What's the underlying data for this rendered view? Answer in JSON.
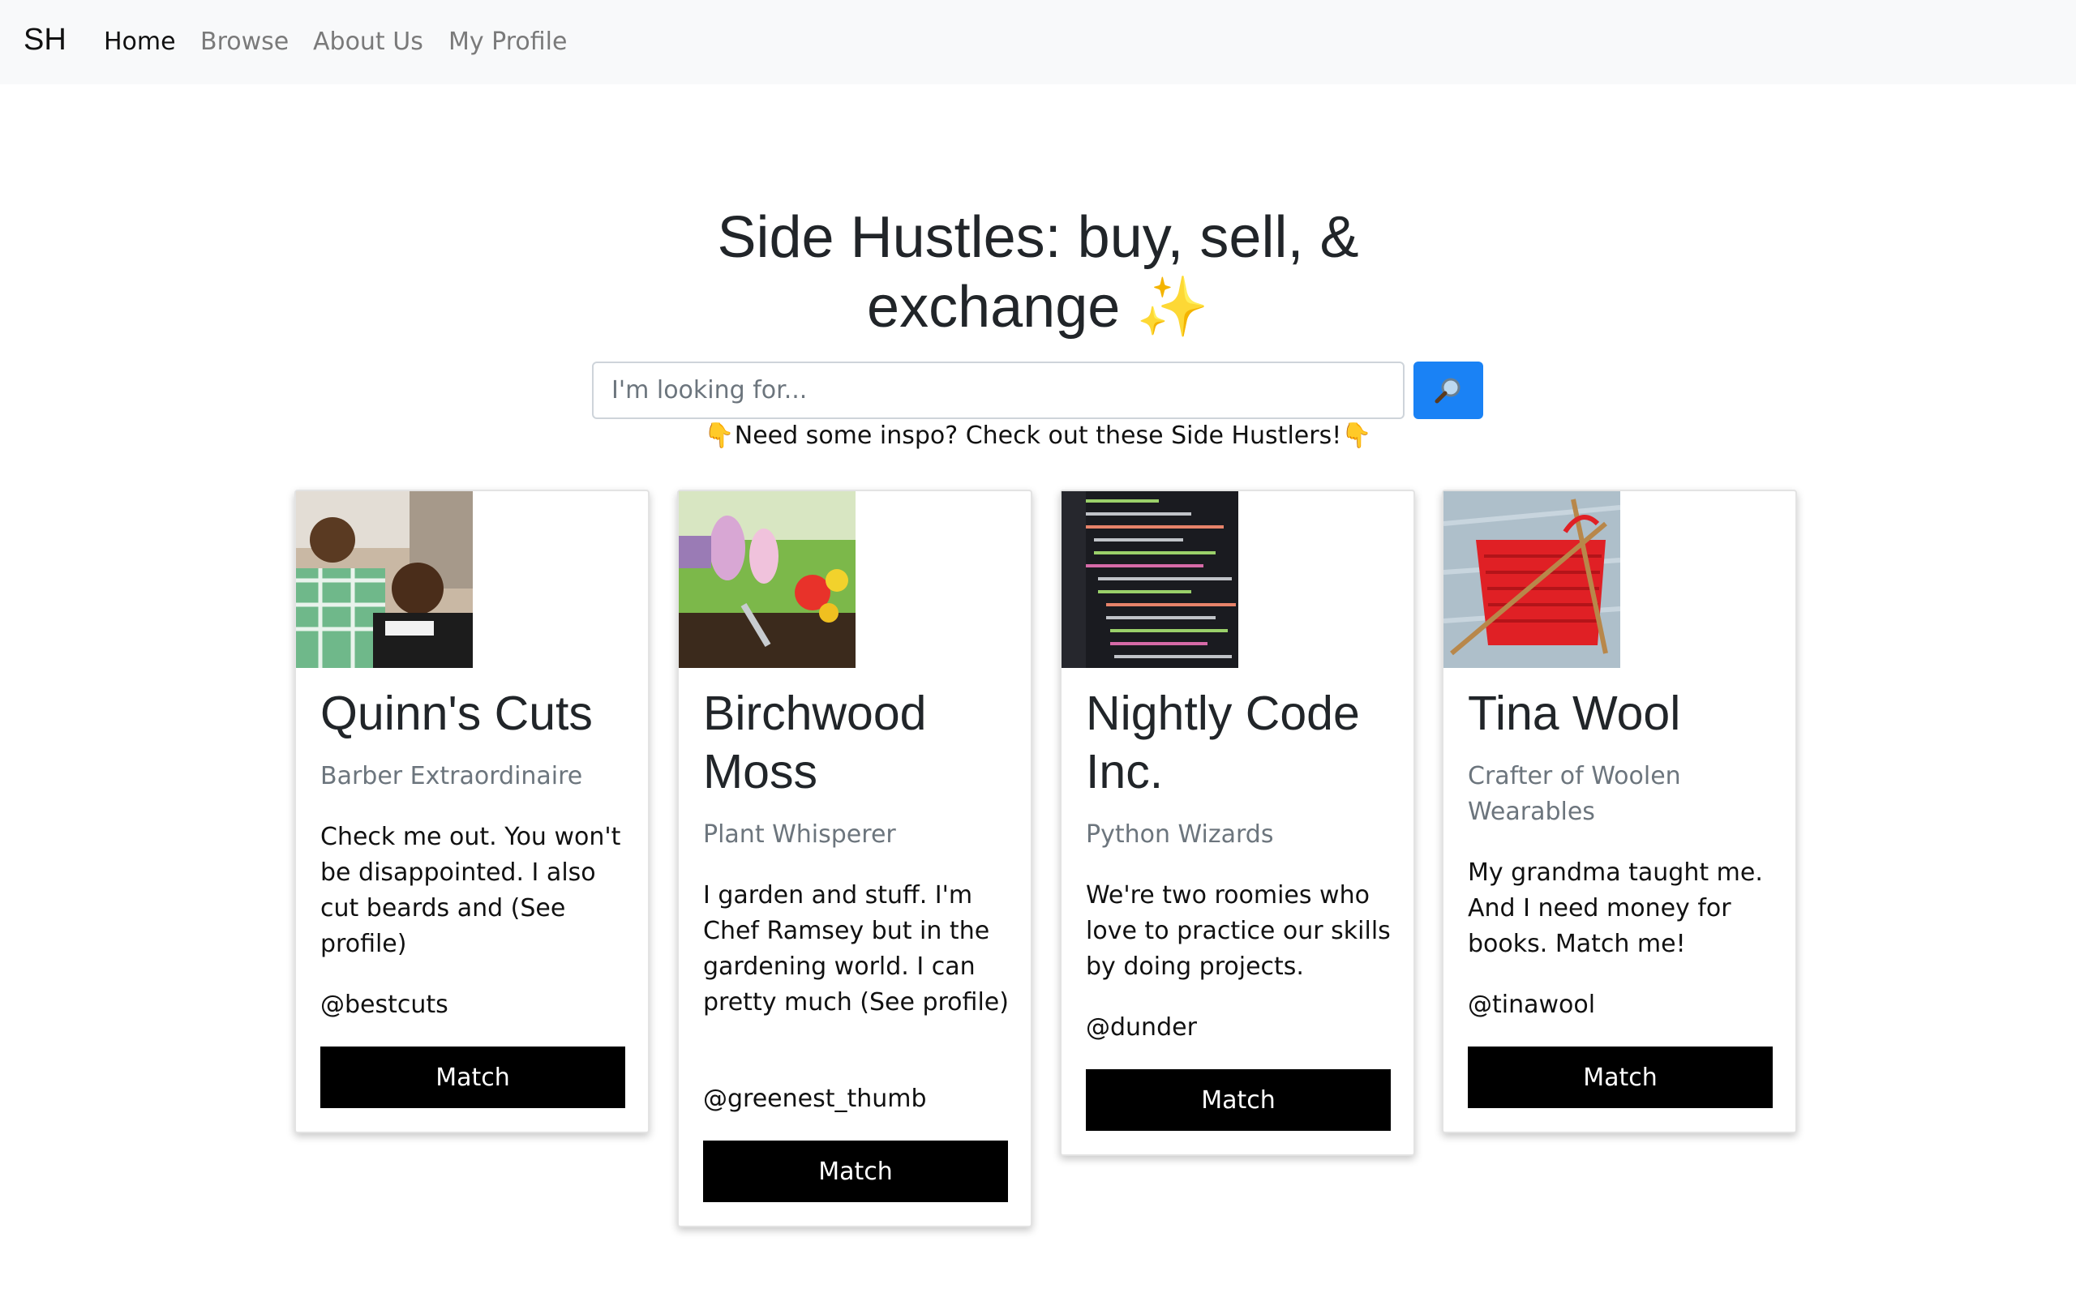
{
  "nav": {
    "brand": "SH",
    "links": [
      {
        "label": "Home",
        "active": true
      },
      {
        "label": "Browse",
        "active": false
      },
      {
        "label": "About Us",
        "active": false
      },
      {
        "label": "My Profile",
        "active": false
      }
    ]
  },
  "hero": {
    "title_line1": "Side Hustles: buy, sell, &",
    "title_line2": "exchange",
    "title_emoji": "✨"
  },
  "search": {
    "placeholder": "I'm looking for...",
    "value": "",
    "button_icon": "magnifying-glass-icon"
  },
  "inspo": {
    "emoji": "👇",
    "text": "Need some inspo? Check out these Side Hustlers!"
  },
  "cards": [
    {
      "title": "Quinn's Cuts",
      "subtitle": "Barber Extraordinaire",
      "text": "Check me out. You won't be disappointed. I also cut beards and (See profile)",
      "handle": "@bestcuts",
      "button": "Match",
      "image": "barbers-photo"
    },
    {
      "title": "Birchwood Moss",
      "subtitle": "Plant Whisperer",
      "text": "I garden and stuff. I'm Chef Ramsey but in the gardening world. I can pretty much (See profile)",
      "handle": "@greenest_thumb",
      "button": "Match",
      "image": "garden-photo"
    },
    {
      "title": "Nightly Code Inc.",
      "subtitle": "Python Wizards",
      "text": "We're two roomies who love to practice our skills by doing projects.",
      "handle": "@dunder",
      "button": "Match",
      "image": "code-screen-photo"
    },
    {
      "title": "Tina Wool",
      "subtitle": "Crafter of Woolen Wearables",
      "text": "My grandma taught me. And I need money for books. Match me!",
      "handle": "@tinawool",
      "button": "Match",
      "image": "knitting-photo"
    }
  ],
  "colors": {
    "navbar_bg": "#f8f9fa",
    "search_button": "#1a82f5",
    "match_button": "#000000",
    "subtitle": "#6c757d"
  }
}
